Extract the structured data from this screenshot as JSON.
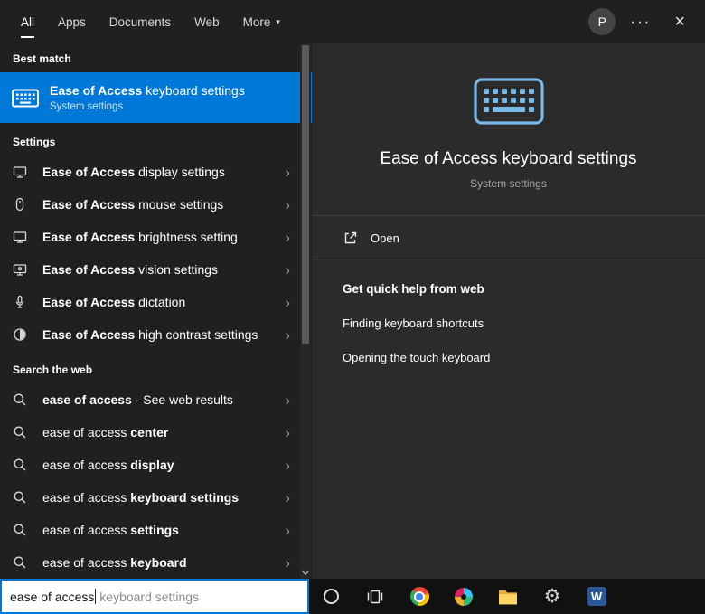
{
  "topbar": {
    "tabs": [
      "All",
      "Apps",
      "Documents",
      "Web",
      "More"
    ],
    "avatar_initial": "P"
  },
  "left": {
    "best_match_header": "Best match",
    "best_match": {
      "title_bold": "Ease of Access",
      "title_rest": " keyboard settings",
      "subtitle": "System settings"
    },
    "settings_header": "Settings",
    "settings_items": [
      {
        "bold": "Ease of Access",
        "rest": " display settings"
      },
      {
        "bold": "Ease of Access",
        "rest": " mouse settings"
      },
      {
        "bold": "Ease of Access",
        "rest": " brightness setting"
      },
      {
        "bold": "Ease of Access",
        "rest": " vision settings"
      },
      {
        "bold": "Ease of Access",
        "rest": " dictation"
      },
      {
        "bold": "Ease of Access",
        "rest": " high contrast settings"
      }
    ],
    "web_header": "Search the web",
    "web_items": [
      {
        "prefix": "ease of access",
        "suffix": " - See web results"
      },
      {
        "prefix": "ease of access",
        "suffix": " center"
      },
      {
        "prefix": "ease of access",
        "suffix": " display"
      },
      {
        "prefix": "ease of access",
        "suffix": " keyboard settings"
      },
      {
        "prefix": "ease of access",
        "suffix": " settings"
      },
      {
        "prefix": "ease of access",
        "suffix": " keyboard"
      }
    ]
  },
  "preview": {
    "title": "Ease of Access keyboard settings",
    "subtitle": "System settings",
    "open_label": "Open",
    "help_header": "Get quick help from web",
    "links": [
      "Finding keyboard shortcuts",
      "Opening the touch keyboard"
    ]
  },
  "search": {
    "typed": "ease of access",
    "suggestion": " keyboard settings"
  },
  "icons": {
    "more_arrow": "▾",
    "ellipsis": "···",
    "close": "×",
    "chevron": "›",
    "gear": "⚙",
    "word_letter": "W"
  },
  "colors": {
    "accent": "#0078d7",
    "best_match_bg": "#0078d7",
    "panel_left": "#202020",
    "panel_right": "#2b2b2b",
    "taskbar": "#111111"
  }
}
